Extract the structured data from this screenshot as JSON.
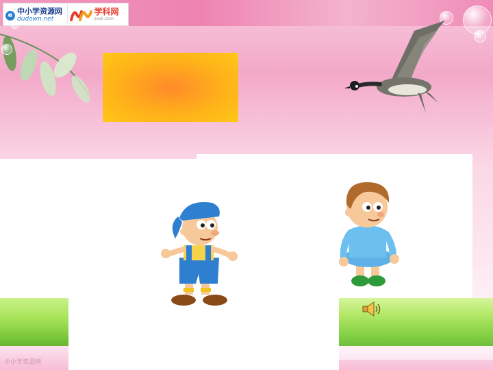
{
  "header": {
    "logo_left": {
      "line1": "中小学资源网",
      "line2": "dudown.net",
      "icon": "e-globe-icon"
    },
    "logo_right": {
      "name": "学科网",
      "url": "zxxk.com",
      "icon": "zxxk-m-logo-icon"
    }
  },
  "slide": {
    "title_box_color": "#ffb11a",
    "decorations": [
      "leaf-branch-icon",
      "flying-goose-icon",
      "bubble-icon"
    ],
    "characters": [
      "boy-blue-cap",
      "boy-sitting"
    ],
    "audio_button_icon": "speaker-icon"
  },
  "footer": {
    "watermark": "中小学资源网"
  },
  "colors": {
    "pink": "#f3a9c9",
    "grass": "#86d146",
    "orange": "#ff8a2a"
  }
}
